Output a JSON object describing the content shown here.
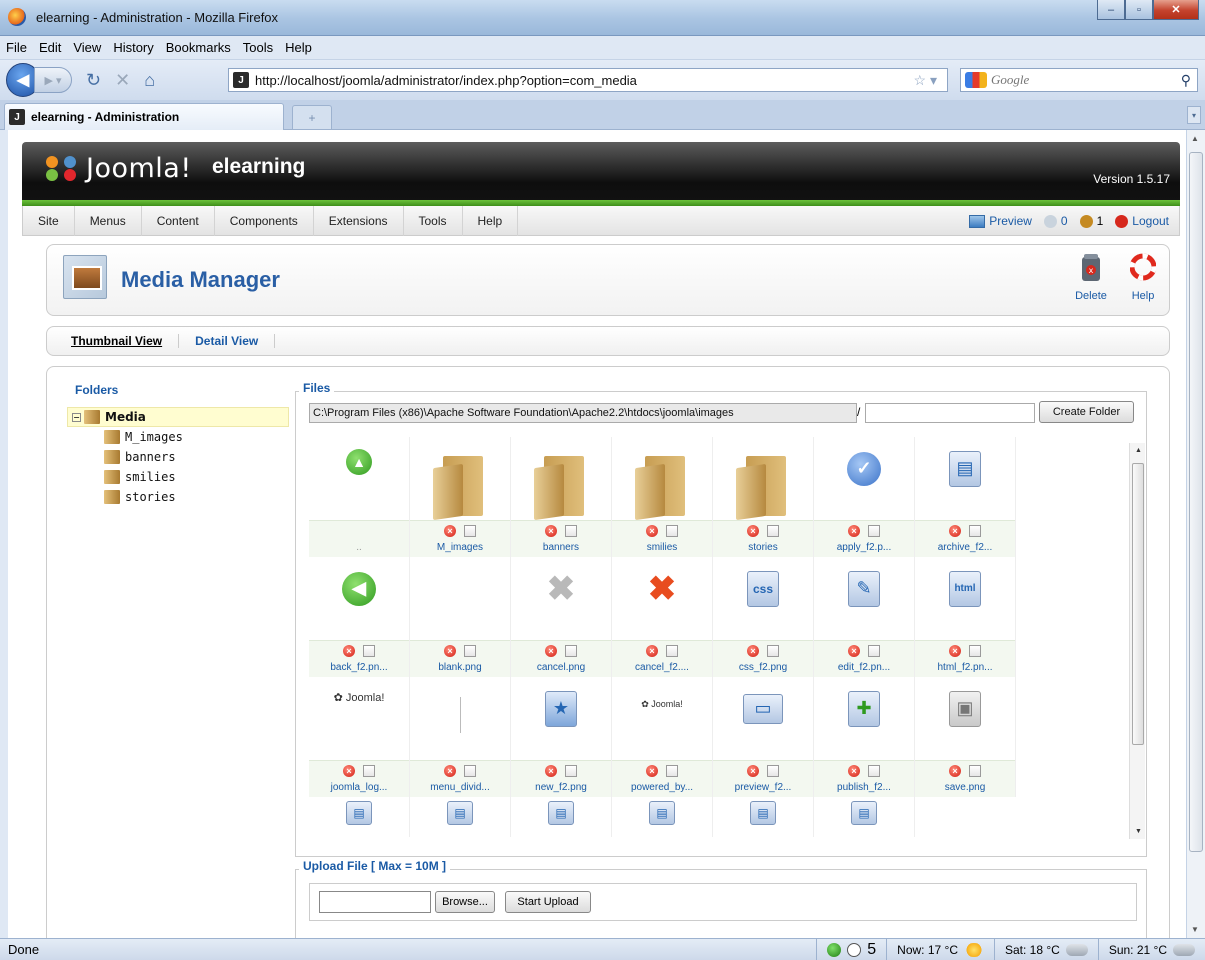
{
  "window": {
    "title": "elearning - Administration - Mozilla Firefox",
    "minimize": "–",
    "maximize": "▫",
    "close": "✕"
  },
  "menubar": [
    "File",
    "Edit",
    "View",
    "History",
    "Bookmarks",
    "Tools",
    "Help"
  ],
  "navigation": {
    "url": "http://localhost/joomla/administrator/index.php?option=com_media",
    "search_placeholder": "Google"
  },
  "tab": {
    "label": "elearning - Administration",
    "newtab": "+"
  },
  "joomla": {
    "brand": "Joomla!",
    "site_name": "elearning",
    "version": "Version 1.5.17",
    "menu": [
      "Site",
      "Menus",
      "Content",
      "Components",
      "Extensions",
      "Tools",
      "Help"
    ],
    "preview": "Preview",
    "messages_count": "0",
    "users_count": "1",
    "logout": "Logout"
  },
  "toolbar": {
    "title": "Media Manager",
    "delete_label": "Delete",
    "help_label": "Help"
  },
  "views": {
    "thumbnail": "Thumbnail View",
    "detail": "Detail View"
  },
  "folders": {
    "heading": "Folders",
    "root": "Media",
    "children": [
      "M_images",
      "banners",
      "smilies",
      "stories"
    ]
  },
  "files": {
    "heading": "Files",
    "path": "C:\\Program Files (x86)\\Apache Software Foundation\\Apache2.2\\htdocs\\joomla\\images",
    "separator": "/",
    "create_folder": "Create Folder",
    "items": [
      {
        "name": "..",
        "icon": "up-arrow-icon"
      },
      {
        "name": "M_images",
        "icon": "folder-icon"
      },
      {
        "name": "banners",
        "icon": "folder-icon"
      },
      {
        "name": "smilies",
        "icon": "folder-icon"
      },
      {
        "name": "stories",
        "icon": "folder-icon"
      },
      {
        "name": "apply_f2.p...",
        "icon": "apply-check-icon"
      },
      {
        "name": "archive_f2...",
        "icon": "archive-icon"
      },
      {
        "name": "back_f2.pn...",
        "icon": "back-arrow-icon"
      },
      {
        "name": "blank.png",
        "icon": "blank-icon"
      },
      {
        "name": "cancel.png",
        "icon": "cancel-grey-x-icon"
      },
      {
        "name": "cancel_f2....",
        "icon": "cancel-red-x-icon"
      },
      {
        "name": "css_f2.png",
        "icon": "css-globe-icon"
      },
      {
        "name": "edit_f2.pn...",
        "icon": "edit-icon"
      },
      {
        "name": "html_f2.pn...",
        "icon": "html-globe-icon"
      },
      {
        "name": "joomla_log...",
        "icon": "joomla-logo-icon"
      },
      {
        "name": "menu_divid...",
        "icon": "menu-divider-icon"
      },
      {
        "name": "new_f2.png",
        "icon": "new-icon"
      },
      {
        "name": "powered_by...",
        "icon": "powered-by-icon"
      },
      {
        "name": "preview_f2...",
        "icon": "preview-monitor-icon"
      },
      {
        "name": "publish_f2...",
        "icon": "publish-icon"
      },
      {
        "name": "save.png",
        "icon": "save-disk-icon"
      }
    ]
  },
  "upload": {
    "heading": "Upload File [ Max = 10M ]",
    "browse": "Browse...",
    "start": "Start Upload"
  },
  "status": {
    "text": "Done",
    "counter": "5",
    "now": "Now: 17 °C",
    "sat": "Sat: 18 °C",
    "sun": "Sun: 21 °C"
  },
  "colors": {
    "joomla_link": "#1a5aa5",
    "header_green": "#4aa02a",
    "cell_bg": "#f3f8f0"
  }
}
